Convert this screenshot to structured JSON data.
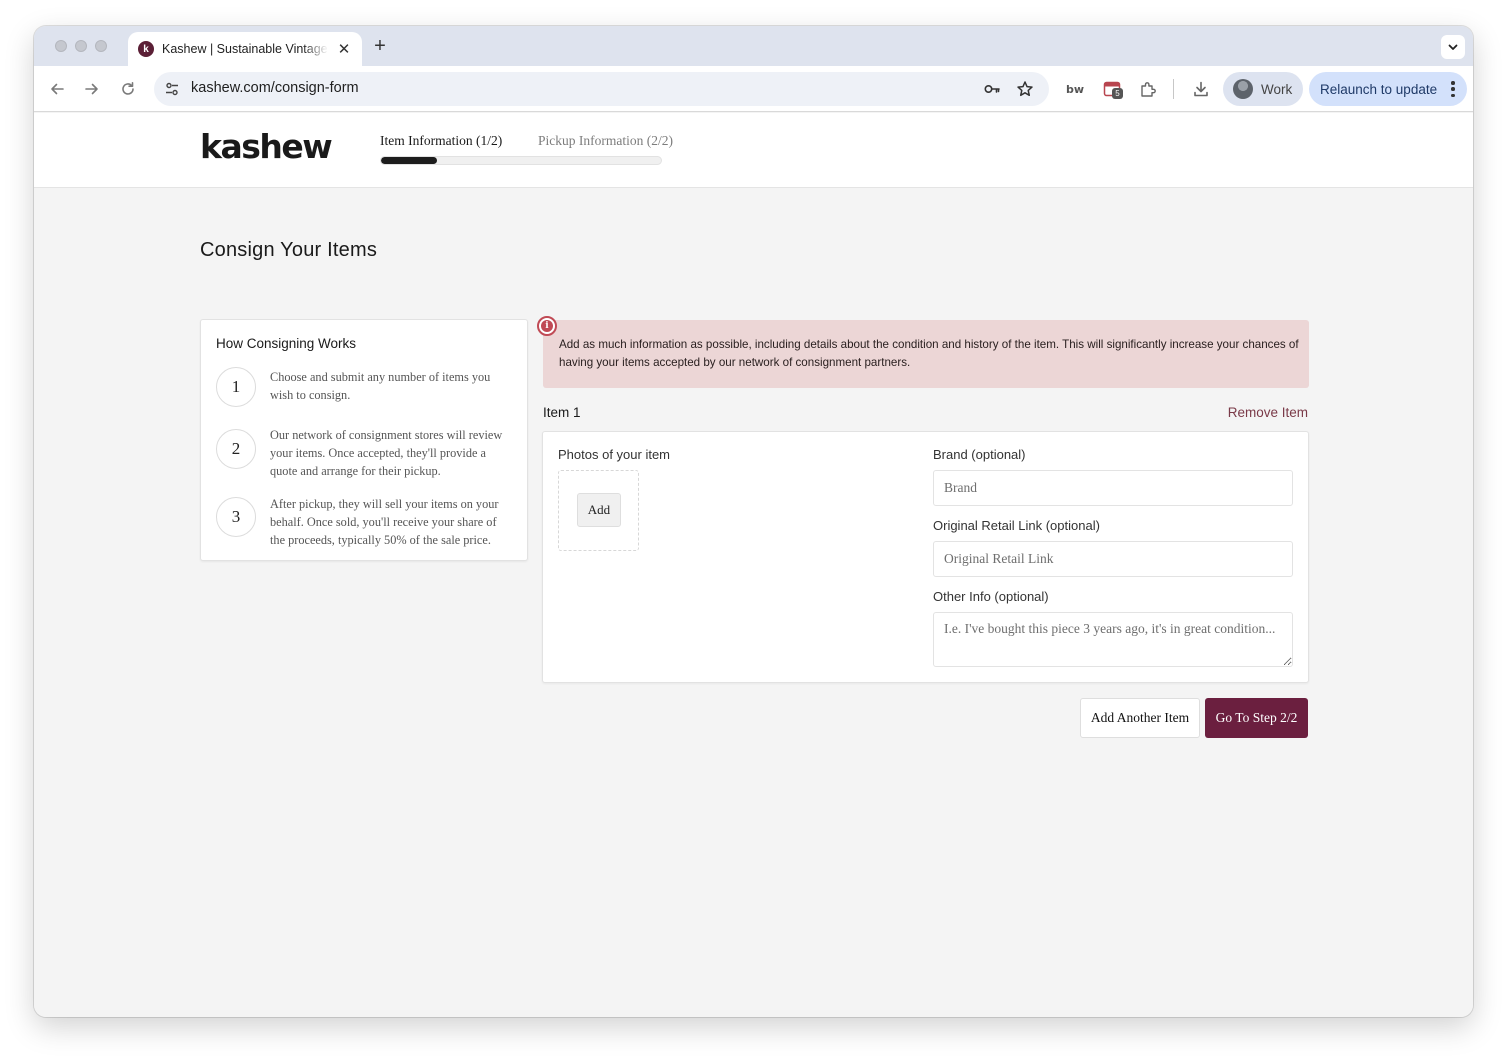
{
  "browser": {
    "tab_title": "Kashew | Sustainable Vintage Furniture",
    "tab_favicon_letter": "k",
    "url": "kashew.com/consign-form",
    "profile_label": "Work",
    "relaunch_label": "Relaunch to update",
    "extension_badge": "5",
    "icons": {
      "back": "arrow-left-icon",
      "forward": "arrow-right-icon",
      "reload": "reload-icon",
      "site_info": "tune-icon",
      "password": "key-icon",
      "bookmark": "star-icon",
      "extension_bw": "bw-extension-icon",
      "extension_calendar": "calendar-extension-icon",
      "extensions": "puzzle-icon",
      "downloads": "download-icon",
      "menu": "kebab-menu-icon"
    }
  },
  "header": {
    "logo": "kashew",
    "steps": [
      {
        "label": "Item Information (1/2)",
        "active": true
      },
      {
        "label": "Pickup Information (2/2)",
        "active": false
      }
    ],
    "progress_fraction": 0.2
  },
  "page_title": "Consign Your Items",
  "how_it_works": {
    "title": "How Consigning Works",
    "steps": [
      {
        "number": "1",
        "text": "Choose and submit any number of items you wish to consign."
      },
      {
        "number": "2",
        "text": "Our network of consignment stores will review your items. Once accepted, they'll provide a quote and arrange for their pickup."
      },
      {
        "number": "3",
        "text": "After pickup, they will sell your items on your behalf. Once sold, you'll receive your share of the proceeds, typically 50% of the sale price."
      }
    ]
  },
  "alert": {
    "icon": "info-icon",
    "text": "Add as much information as possible, including details about the condition and history of the item. This will significantly increase your chances of having your items accepted by our network of consignment partners."
  },
  "item": {
    "label": "Item 1",
    "remove_label": "Remove Item",
    "photos_label": "Photos of your item",
    "add_photo_label": "Add",
    "brand_label": "Brand (optional)",
    "brand_placeholder": "Brand",
    "brand_value": "",
    "retail_label": "Original Retail Link (optional)",
    "retail_placeholder": "Original Retail Link",
    "retail_value": "",
    "other_label": "Other Info (optional)",
    "other_placeholder": "I.e. I've bought this piece 3 years ago, it's in great condition...",
    "other_value": ""
  },
  "actions": {
    "add_another": "Add Another Item",
    "next_step": "Go To Step 2/2"
  },
  "colors": {
    "brand": "#6b1f3f",
    "alert_bg": "#ecd6d6",
    "alert_icon": "#c04a55",
    "remove_link": "#7a3a48"
  }
}
